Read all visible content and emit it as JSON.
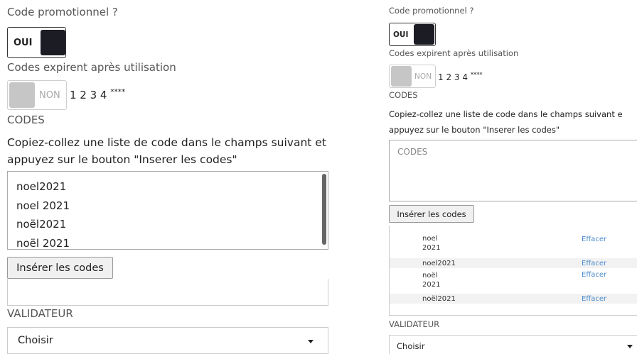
{
  "left": {
    "promo_label": "Code promotionnel ?",
    "promo_toggle_label": "OUI",
    "expire_label": "Codes expirent après utilisation",
    "expire_toggle_label": "NON",
    "mask_digits": "1 2 3 4",
    "mask_stars": "****",
    "codes_heading": "CODES",
    "help_text": "Copiez-collez une liste de code dans le champs suivant et appuyez sur le bouton \"Inserer les codes\"",
    "textarea_lines": [
      "noel2021",
      "noel 2021",
      "noël2021",
      "noël 2021"
    ],
    "insert_button": "Insérer les codes",
    "validator_label": "VALIDATEUR",
    "validator_value": "Choisir"
  },
  "right": {
    "promo_label": "Code promotionnel ?",
    "promo_toggle_label": "OUI",
    "expire_label": "Codes expirent après utilisation",
    "expire_toggle_label": "NON",
    "mask_digits": "1 2 3 4",
    "mask_stars": "****",
    "codes_heading": "CODES",
    "help_line1": "Copiez-collez une liste de code dans le champs suivant e",
    "help_line2": "appuyez sur le bouton \"Inserer les codes\"",
    "textarea_placeholder": "CODES",
    "insert_button": "Insérer les codes",
    "codes": [
      {
        "text": "noel\n2021",
        "delete": "Effacer"
      },
      {
        "text": "noel2021",
        "delete": "Effacer"
      },
      {
        "text": "noël\n2021",
        "delete": "Effacer"
      },
      {
        "text": "noël2021",
        "delete": "Effacer"
      }
    ],
    "validator_label": "VALIDATEUR",
    "validator_value": "Choisir"
  },
  "colors": {
    "toggle_on": "#1c1c24",
    "toggle_off": "#c6c6c6",
    "link": "#4a8ccc"
  }
}
